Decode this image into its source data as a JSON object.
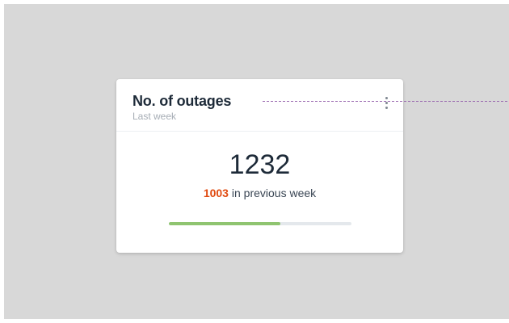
{
  "card": {
    "title": "No. of outages",
    "subtitle": "Last week",
    "value": "1232",
    "previous_value": "1003",
    "previous_suffix": " in previous week",
    "progress_fraction": 0.61,
    "menu_icon": "more-vertical-icon"
  },
  "colors": {
    "background": "#d8d8d8",
    "card": "#ffffff",
    "title": "#1d2a38",
    "subtitle": "#a6adb5",
    "previous_value": "#e04a10",
    "progress_fill": "#8fc470",
    "progress_track": "#e4e8ec",
    "connector": "#9b6bb0"
  }
}
